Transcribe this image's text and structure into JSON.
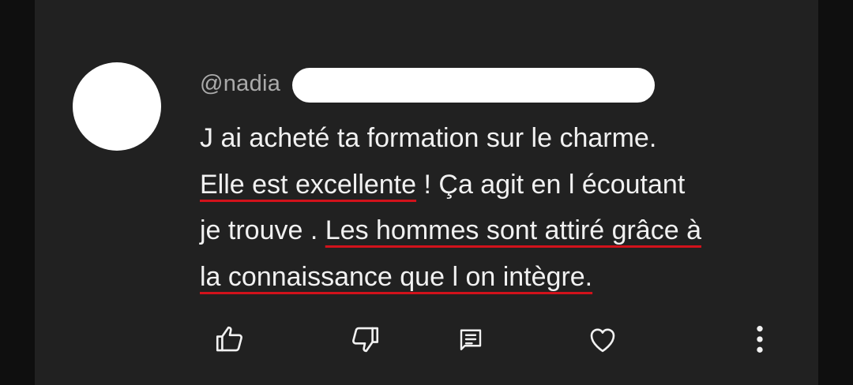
{
  "comment": {
    "author": "@nadia",
    "lines": [
      {
        "a": "J ai acheté ta formation sur le charme.",
        "u": "",
        "b": ""
      },
      {
        "a": "",
        "u": "Elle est excellente",
        "b": " ! Ça agit en l écoutant"
      },
      {
        "a": "je trouve . ",
        "u": "Les hommes sont attiré grâce à",
        "b": ""
      },
      {
        "a": "",
        "u": "la connaissance que l on intègre.",
        "b": ""
      }
    ]
  },
  "icons": {
    "like": "thumbs-up-icon",
    "dislike": "thumbs-down-icon",
    "reply": "reply-comment-icon",
    "heart": "heart-icon",
    "more": "more-vertical-icon"
  },
  "colors": {
    "background": "#212121",
    "text": "#f1f1f1",
    "username": "#aaaaaa",
    "underline": "#d2121b"
  }
}
